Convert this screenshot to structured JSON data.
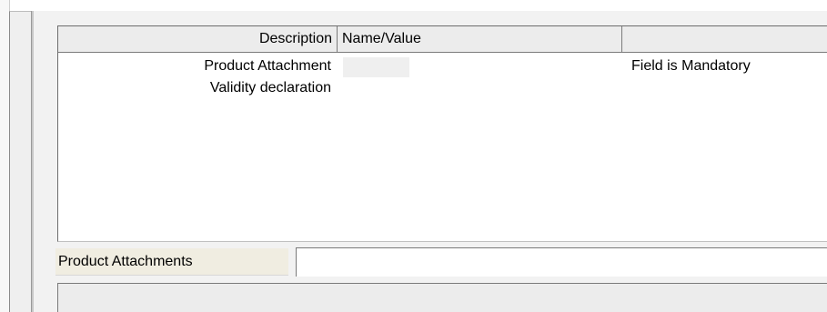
{
  "table": {
    "columns": {
      "description": "Description",
      "name_value": "Name/Value",
      "extra": ""
    },
    "rows": [
      {
        "description": "Product Attachment",
        "value": "",
        "status": "Field is Mandatory"
      },
      {
        "description": "Validity declaration",
        "value": "",
        "status": ""
      }
    ]
  },
  "attachments": {
    "label": "Product Attachments",
    "value": ""
  },
  "colors": {
    "label_bg": "#f0ede1",
    "header_bg": "#ececec",
    "panel_bg": "#f2f2f2"
  }
}
